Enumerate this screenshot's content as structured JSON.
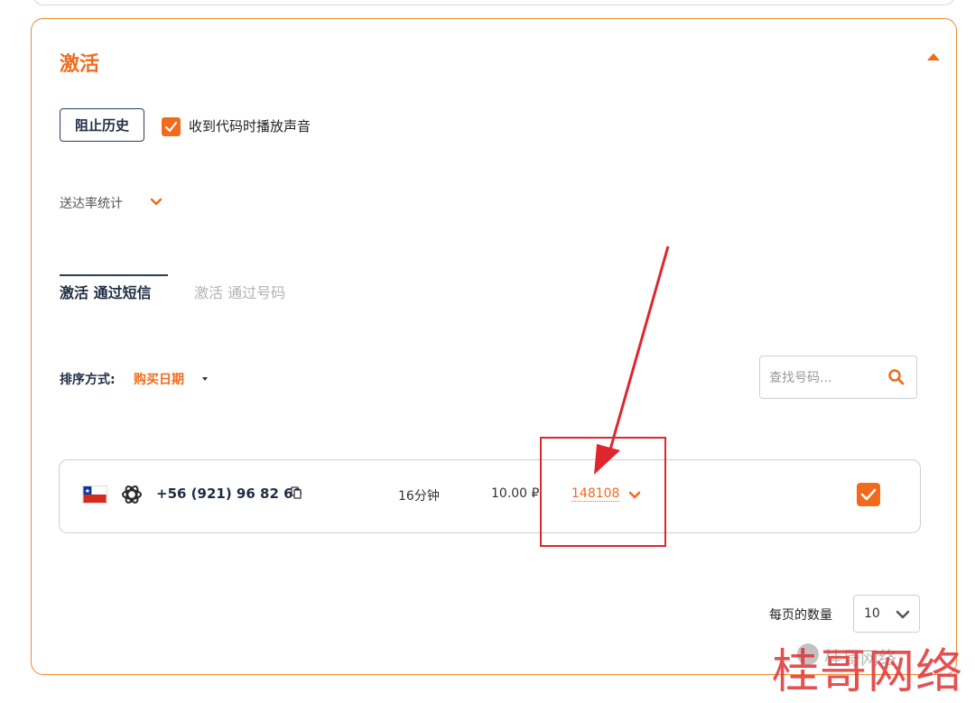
{
  "panel": {
    "title": "激活",
    "block_history_label": "阻止历史",
    "play_sound_label": "收到代码时播放声音",
    "play_sound_checked": true,
    "delivery_stats_label": "送达率统计"
  },
  "tabs": [
    {
      "label": "激活 通过短信",
      "active": true
    },
    {
      "label": "激活 通过号码",
      "active": false
    }
  ],
  "sort": {
    "label": "排序方式:",
    "value": "购买日期"
  },
  "search": {
    "placeholder": "查找号码..."
  },
  "activations": [
    {
      "country_flag": "chile-flag-icon",
      "service_icon": "openai-icon",
      "phone": "+56 (921) 96 82 69",
      "time_left": "16分钟",
      "price": "10.00 ₽",
      "code": "148108",
      "selected": true
    }
  ],
  "pagination": {
    "per_page_label": "每页的数量",
    "per_page_value": "10"
  },
  "watermark": {
    "small_text": "桂哥网络",
    "large_text": "桂哥网络"
  },
  "colors": {
    "accent": "#f26b1d",
    "panel_border": "#f08a2e",
    "annotation_red": "#e0262d",
    "dark_text": "#1f2d45"
  }
}
